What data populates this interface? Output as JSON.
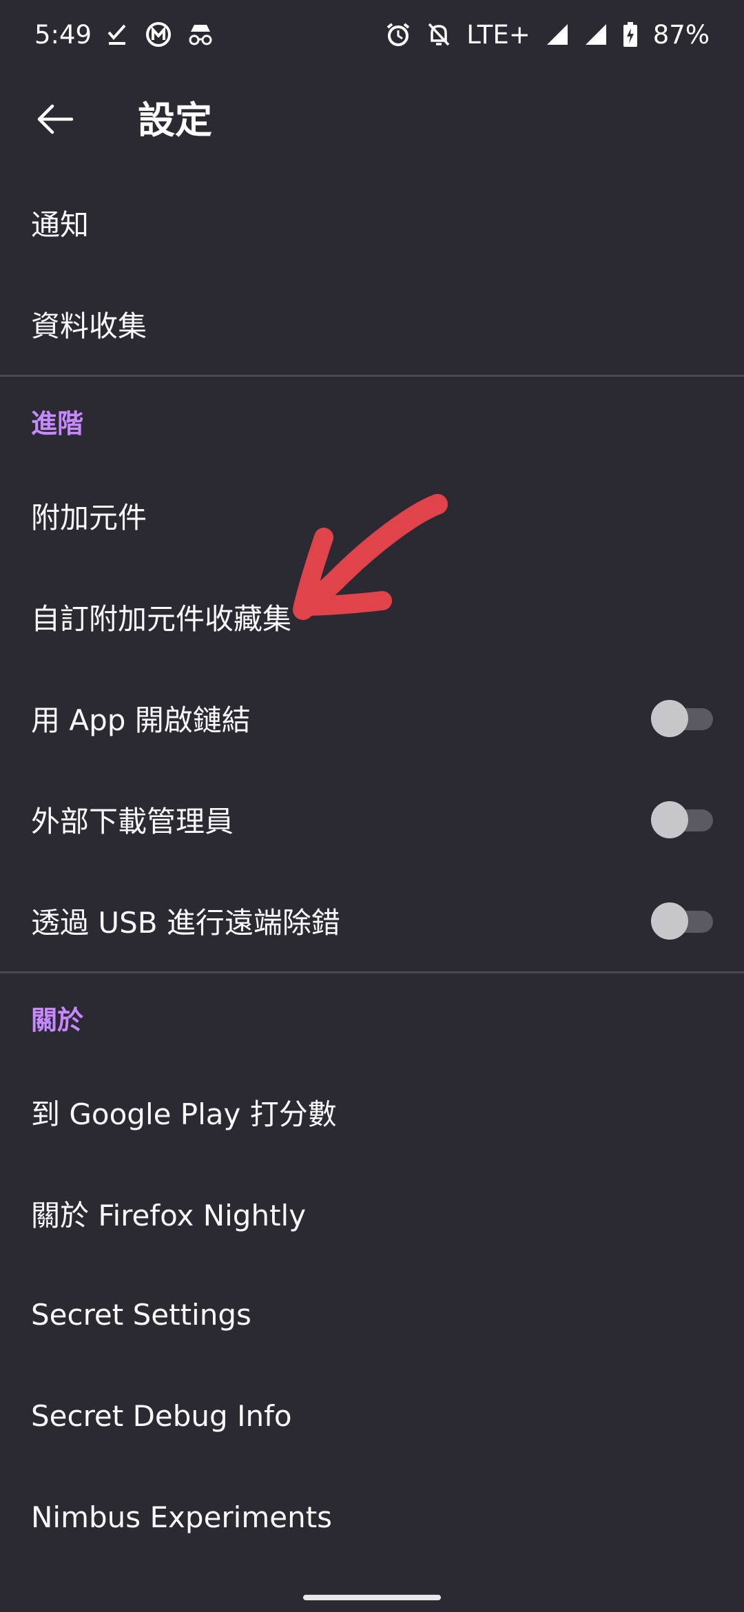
{
  "status_bar": {
    "time": "5:49",
    "network": "LTE+",
    "battery": "87%",
    "icons": [
      "check-download-icon",
      "m-app-icon",
      "incognito-icon",
      "alarm-icon",
      "mute-bell-icon",
      "signal-icon",
      "signal-icon",
      "battery-charging-icon"
    ]
  },
  "app_bar": {
    "title": "設定",
    "back_icon": "arrow-left-icon"
  },
  "list": {
    "notifications": "通知",
    "data_collection": "資料收集",
    "advanced_header": "進階",
    "addons": "附加元件",
    "custom_addon_collection": "自訂附加元件收藏集",
    "open_links_in_apps": {
      "label": "用 App 開啟鏈結",
      "checked": false
    },
    "external_download_manager": {
      "label": "外部下載管理員",
      "checked": false
    },
    "remote_debugging": {
      "label": "透過 USB 進行遠端除錯",
      "checked": false
    },
    "about_header": "關於",
    "rate_on_google_play": "到 Google Play 打分數",
    "about_firefox_nightly": "關於 Firefox Nightly",
    "secret_settings": "Secret Settings",
    "secret_debug_info": "Secret Debug Info",
    "nimbus_experiments": "Nimbus Experiments"
  },
  "colors": {
    "background": "#2b2a33",
    "text": "#fbfbfe",
    "section_header": "#c689ff",
    "divider": "#4a4953",
    "toggle_track_off": "#5b5a63",
    "toggle_thumb_off": "#c7c7cb",
    "annotation_arrow": "#e0434a"
  }
}
